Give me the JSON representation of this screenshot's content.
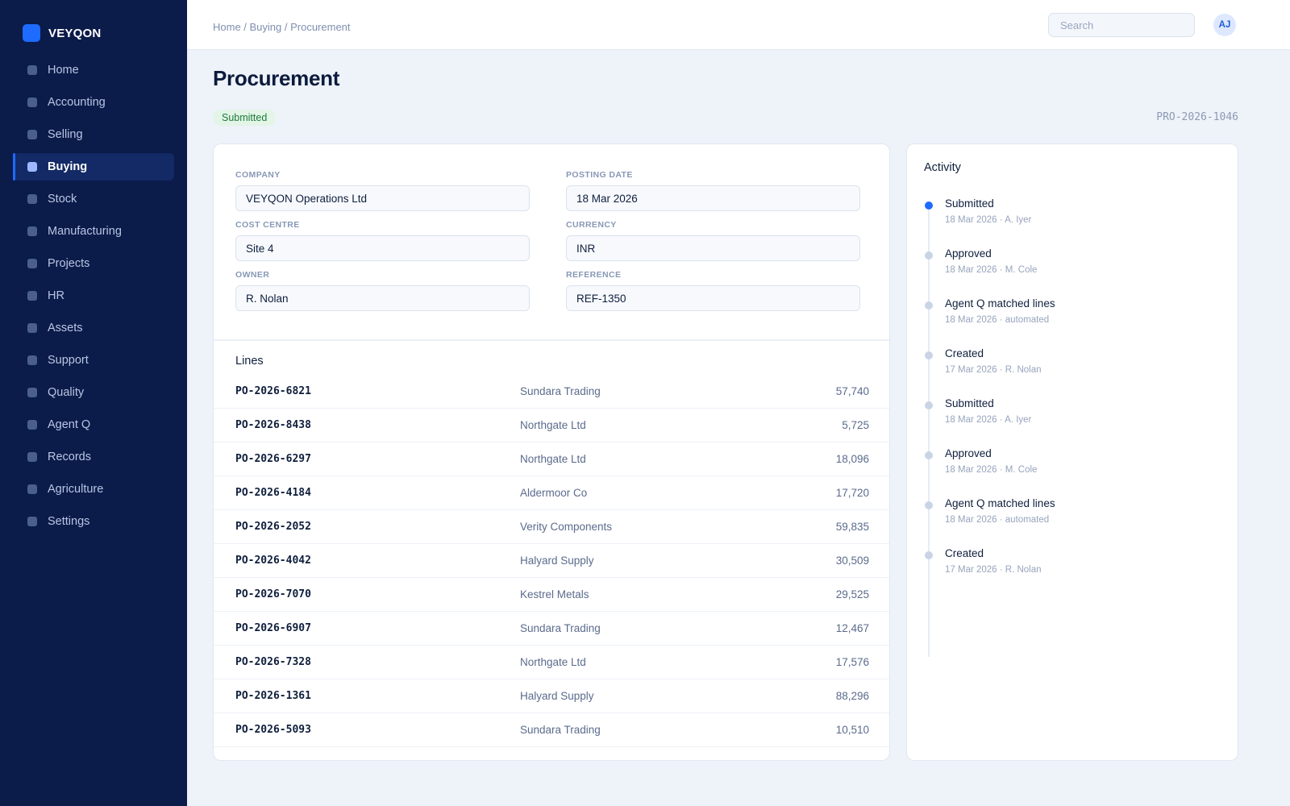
{
  "brand": {
    "name": "VEYQON",
    "accent": "#1e6bff"
  },
  "sidebar": {
    "items": [
      {
        "label": "Home",
        "active": false
      },
      {
        "label": "Accounting",
        "active": false
      },
      {
        "label": "Selling",
        "active": false
      },
      {
        "label": "Buying",
        "active": true
      },
      {
        "label": "Stock",
        "active": false
      },
      {
        "label": "Manufacturing",
        "active": false
      },
      {
        "label": "Projects",
        "active": false
      },
      {
        "label": "HR",
        "active": false
      },
      {
        "label": "Assets",
        "active": false
      },
      {
        "label": "Support",
        "active": false
      },
      {
        "label": "Quality",
        "active": false
      },
      {
        "label": "Agent Q",
        "active": false
      },
      {
        "label": "Records",
        "active": false
      },
      {
        "label": "Agriculture",
        "active": false
      },
      {
        "label": "Settings",
        "active": false
      }
    ]
  },
  "topbar": {
    "breadcrumb": "Home / Buying / Procurement",
    "search_placeholder": "Search",
    "avatar_initials": "AJ"
  },
  "page": {
    "title": "Procurement",
    "status": "Submitted",
    "doc_id": "PRO-2026-1046"
  },
  "form": {
    "company": {
      "label": "COMPANY",
      "value": "VEYQON Operations Ltd"
    },
    "posting_date": {
      "label": "POSTING DATE",
      "value": "18 Mar 2026"
    },
    "cost_centre": {
      "label": "COST CENTRE",
      "value": "Site 4"
    },
    "currency": {
      "label": "CURRENCY",
      "value": "INR"
    },
    "owner": {
      "label": "OWNER",
      "value": "R. Nolan"
    },
    "reference": {
      "label": "REFERENCE",
      "value": "REF-1350"
    }
  },
  "lines": {
    "title": "Lines",
    "rows": [
      {
        "id": "PO-2026-6821",
        "vendor": "Sundara Trading",
        "amount": "57,740"
      },
      {
        "id": "PO-2026-8438",
        "vendor": "Northgate Ltd",
        "amount": "5,725"
      },
      {
        "id": "PO-2026-6297",
        "vendor": "Northgate Ltd",
        "amount": "18,096"
      },
      {
        "id": "PO-2026-4184",
        "vendor": "Aldermoor Co",
        "amount": "17,720"
      },
      {
        "id": "PO-2026-2052",
        "vendor": "Verity Components",
        "amount": "59,835"
      },
      {
        "id": "PO-2026-4042",
        "vendor": "Halyard Supply",
        "amount": "30,509"
      },
      {
        "id": "PO-2026-7070",
        "vendor": "Kestrel Metals",
        "amount": "29,525"
      },
      {
        "id": "PO-2026-6907",
        "vendor": "Sundara Trading",
        "amount": "12,467"
      },
      {
        "id": "PO-2026-7328",
        "vendor": "Northgate Ltd",
        "amount": "17,576"
      },
      {
        "id": "PO-2026-1361",
        "vendor": "Halyard Supply",
        "amount": "88,296"
      },
      {
        "id": "PO-2026-5093",
        "vendor": "Sundara Trading",
        "amount": "10,510"
      }
    ]
  },
  "activity": {
    "title": "Activity",
    "items": [
      {
        "title": "Submitted",
        "meta": "18 Mar 2026 · A. Iyer",
        "current": true
      },
      {
        "title": "Approved",
        "meta": "18 Mar 2026 · M. Cole",
        "current": false
      },
      {
        "title": "Agent Q matched lines",
        "meta": "18 Mar 2026 · automated",
        "current": false
      },
      {
        "title": "Created",
        "meta": "17 Mar 2026 · R. Nolan",
        "current": false
      },
      {
        "title": "Submitted",
        "meta": "18 Mar 2026 · A. Iyer",
        "current": false
      },
      {
        "title": "Approved",
        "meta": "18 Mar 2026 · M. Cole",
        "current": false
      },
      {
        "title": "Agent Q matched lines",
        "meta": "18 Mar 2026 · automated",
        "current": false
      },
      {
        "title": "Created",
        "meta": "17 Mar 2026 · R. Nolan",
        "current": false
      }
    ]
  }
}
